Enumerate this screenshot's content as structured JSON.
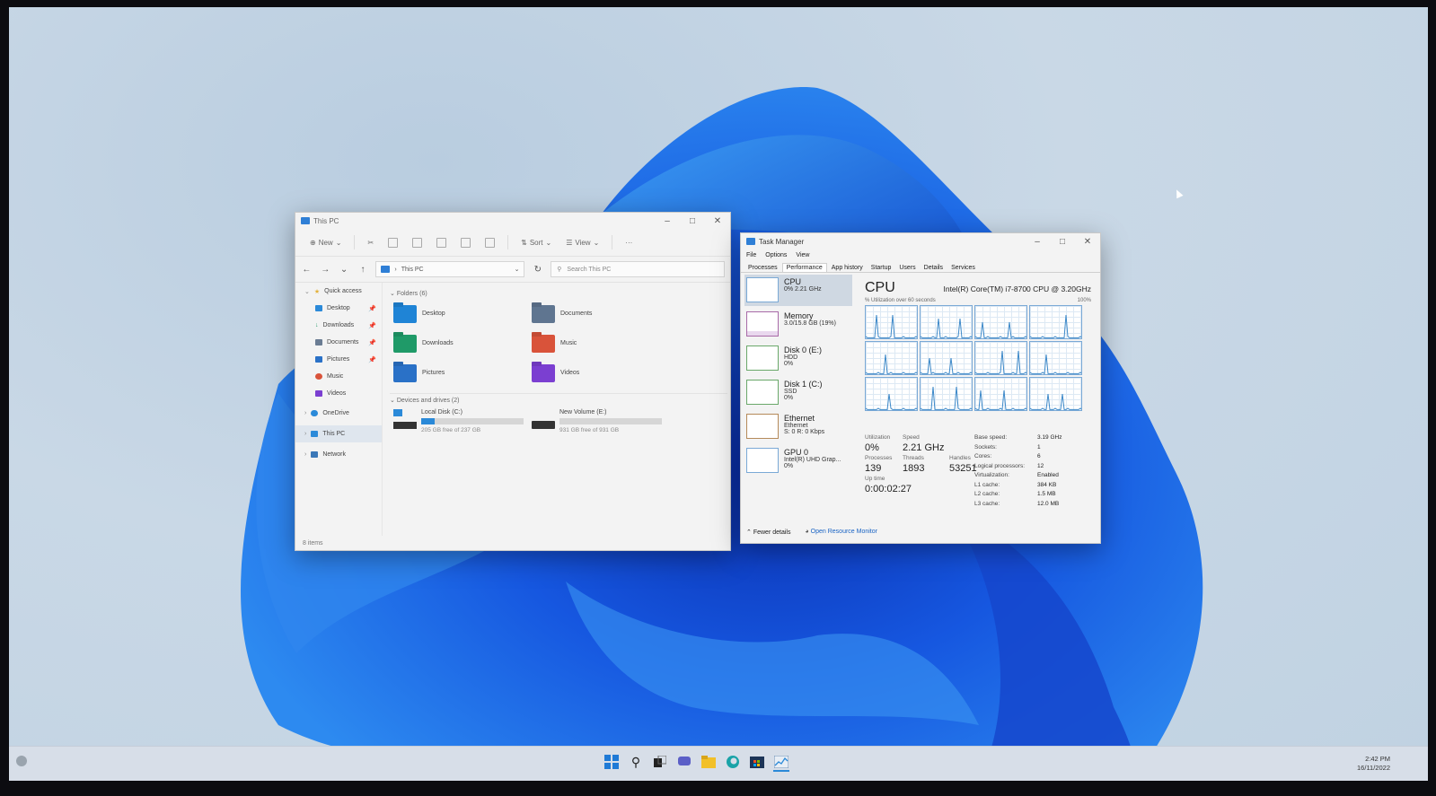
{
  "explorer": {
    "title": "This PC",
    "toolbar": {
      "new": "New",
      "sort": "Sort",
      "view": "View",
      "more": "···"
    },
    "address": "This PC",
    "search_placeholder": "Search This PC",
    "nav": {
      "quick_access": "Quick access",
      "items": [
        "Desktop",
        "Downloads",
        "Documents",
        "Pictures",
        "Music",
        "Videos"
      ],
      "onedrive": "OneDrive",
      "thispc": "This PC",
      "network": "Network"
    },
    "folders_header": "Folders (6)",
    "folders": [
      "Desktop",
      "Documents",
      "Downloads",
      "Music",
      "Pictures",
      "Videos"
    ],
    "devices_header": "Devices and drives (2)",
    "drives": [
      {
        "name": "Local Disk (C:)",
        "free": "205 GB free of 237 GB",
        "used_fraction": 0.135
      },
      {
        "name": "New Volume (E:)",
        "free": "931 GB free of 931 GB",
        "used_fraction": 0.0
      }
    ],
    "status": "8 items"
  },
  "taskmgr": {
    "title": "Task Manager",
    "menu": [
      "File",
      "Options",
      "View"
    ],
    "tabs": [
      "Processes",
      "Performance",
      "App history",
      "Startup",
      "Users",
      "Details",
      "Services"
    ],
    "side": [
      {
        "name": "CPU",
        "l1": "0% 2.21 GHz",
        "l2": ""
      },
      {
        "name": "Memory",
        "l1": "3.0/15.8 GB (19%)",
        "l2": ""
      },
      {
        "name": "Disk 0 (E:)",
        "l1": "HDD",
        "l2": "0%"
      },
      {
        "name": "Disk 1 (C:)",
        "l1": "SSD",
        "l2": "0%"
      },
      {
        "name": "Ethernet",
        "l1": "Ethernet",
        "l2": "S: 0 R: 0 Kbps"
      },
      {
        "name": "GPU 0",
        "l1": "Intel(R) UHD Grap...",
        "l2": "0%"
      }
    ],
    "cpu_heading": "CPU",
    "cpu_model": "Intel(R) Core(TM) i7-8700 CPU @ 3.20GHz",
    "util_label": "% Utilization over 60 seconds",
    "util_max": "100%",
    "stats": {
      "utilization_label": "Utilization",
      "utilization": "0%",
      "speed_label": "Speed",
      "speed": "2.21 GHz",
      "processes_label": "Processes",
      "processes": "139",
      "threads_label": "Threads",
      "threads": "1893",
      "handles_label": "Handles",
      "handles": "53251",
      "uptime_label": "Up time",
      "uptime": "0:00:02:27"
    },
    "specs": [
      {
        "k": "Base speed:",
        "v": "3.19 GHz"
      },
      {
        "k": "Sockets:",
        "v": "1"
      },
      {
        "k": "Cores:",
        "v": "6"
      },
      {
        "k": "Logical processors:",
        "v": "12"
      },
      {
        "k": "Virtualization:",
        "v": "Enabled"
      },
      {
        "k": "L1 cache:",
        "v": "384 KB"
      },
      {
        "k": "L2 cache:",
        "v": "1.5 MB"
      },
      {
        "k": "L3 cache:",
        "v": "12.0 MB"
      }
    ],
    "fewer_details": "Fewer details",
    "resource_monitor": "Open Resource Monitor"
  },
  "taskbar": {
    "time": "2:42 PM",
    "date": "16/11/2022"
  },
  "colors": {
    "accent": "#2a89d8",
    "graph_line": "#3c88c8"
  }
}
